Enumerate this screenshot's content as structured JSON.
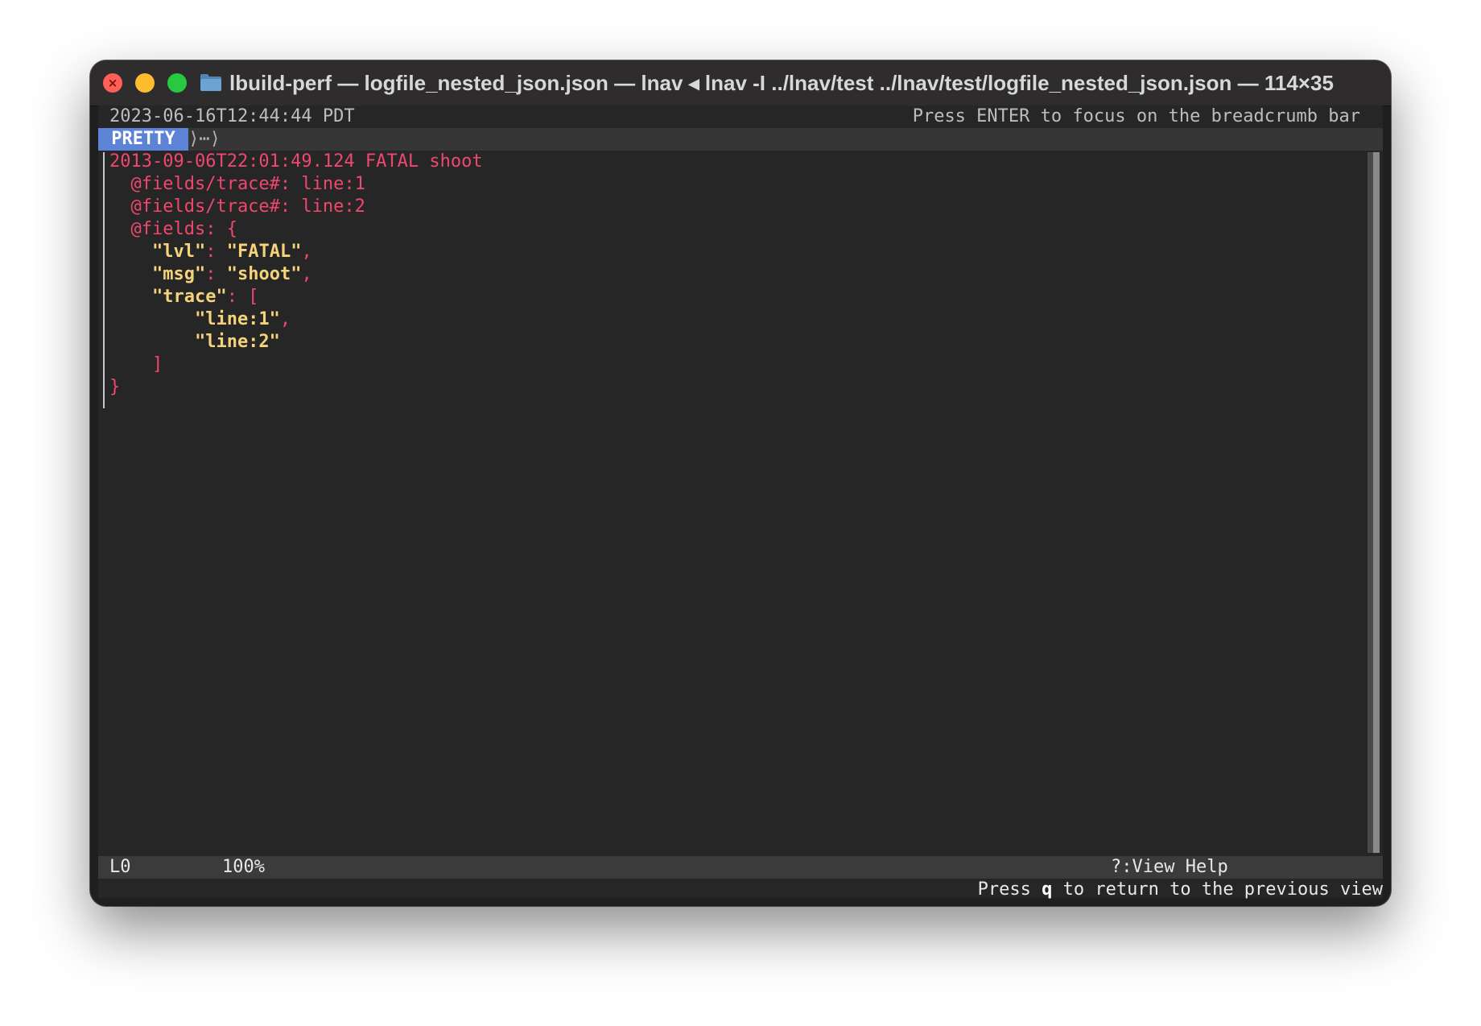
{
  "window": {
    "title": "lbuild-perf — logfile_nested_json.json — lnav ◂ lnav -I ../lnav/test ../lnav/test/logfile_nested_json.json — 114×35"
  },
  "topbar": {
    "timestamp": "2023-06-16T12:44:44 PDT",
    "hint": "Press ENTER to focus on the breadcrumb bar"
  },
  "breadcrumb": {
    "view": "PRETTY",
    "tail": "⟩⋯⟩"
  },
  "content": {
    "header": "2013-09-06T22:01:49.124 FATAL shoot",
    "trace1": "  @fields/trace#: line:1",
    "trace2": "  @fields/trace#: line:2",
    "fields_open": "  @fields: {",
    "lvl_key": "    \"lvl\"",
    "lvl_sep": ": ",
    "lvl_val": "\"FATAL\"",
    "comma": ",",
    "msg_key": "    \"msg\"",
    "msg_sep": ": ",
    "msg_val": "\"shoot\"",
    "trace_key": "    \"trace\"",
    "trace_open": ": [",
    "item1": "        \"line:1\"",
    "item2": "        \"line:2\"",
    "trace_close": "    ]",
    "close": "}"
  },
  "status": {
    "line": "L0",
    "percent": "100%",
    "help": "?:View Help"
  },
  "bottom": {
    "pre": "Press ",
    "key": "q",
    "post": " to return to the previous view"
  },
  "colors": {
    "accent": "#5c83d6",
    "log_fatal": "#f0476e",
    "json_string": "#f5d37a"
  },
  "icons": [
    "close-icon",
    "minimize-icon",
    "maximize-icon",
    "folder-icon"
  ]
}
